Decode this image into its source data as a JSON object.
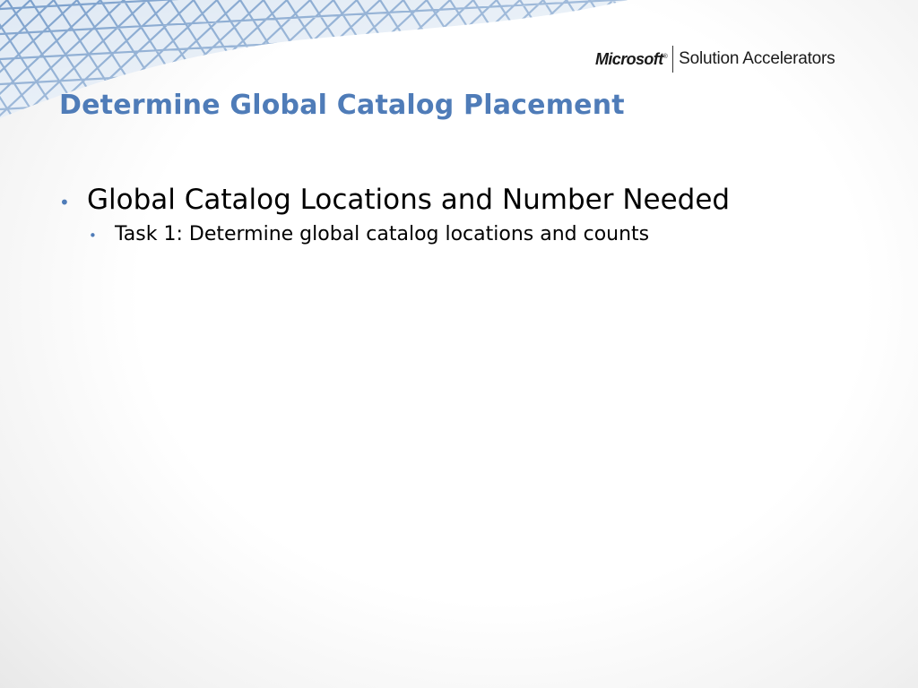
{
  "branding": {
    "company": "Microsoft",
    "trademark": "®",
    "product": "Solution Accelerators"
  },
  "slide": {
    "title": "Determine Global Catalog Placement",
    "bullets": [
      {
        "text": "Global Catalog Locations and Number Needed",
        "children": [
          {
            "text": "Task 1: Determine global catalog locations and counts"
          }
        ]
      }
    ]
  },
  "theme": {
    "accent": "#4f7cb8",
    "text": "#000000",
    "lattice": "#6f97c6"
  },
  "icons": {
    "bullet": "•",
    "decoration": "lattice-structure-graphic"
  }
}
